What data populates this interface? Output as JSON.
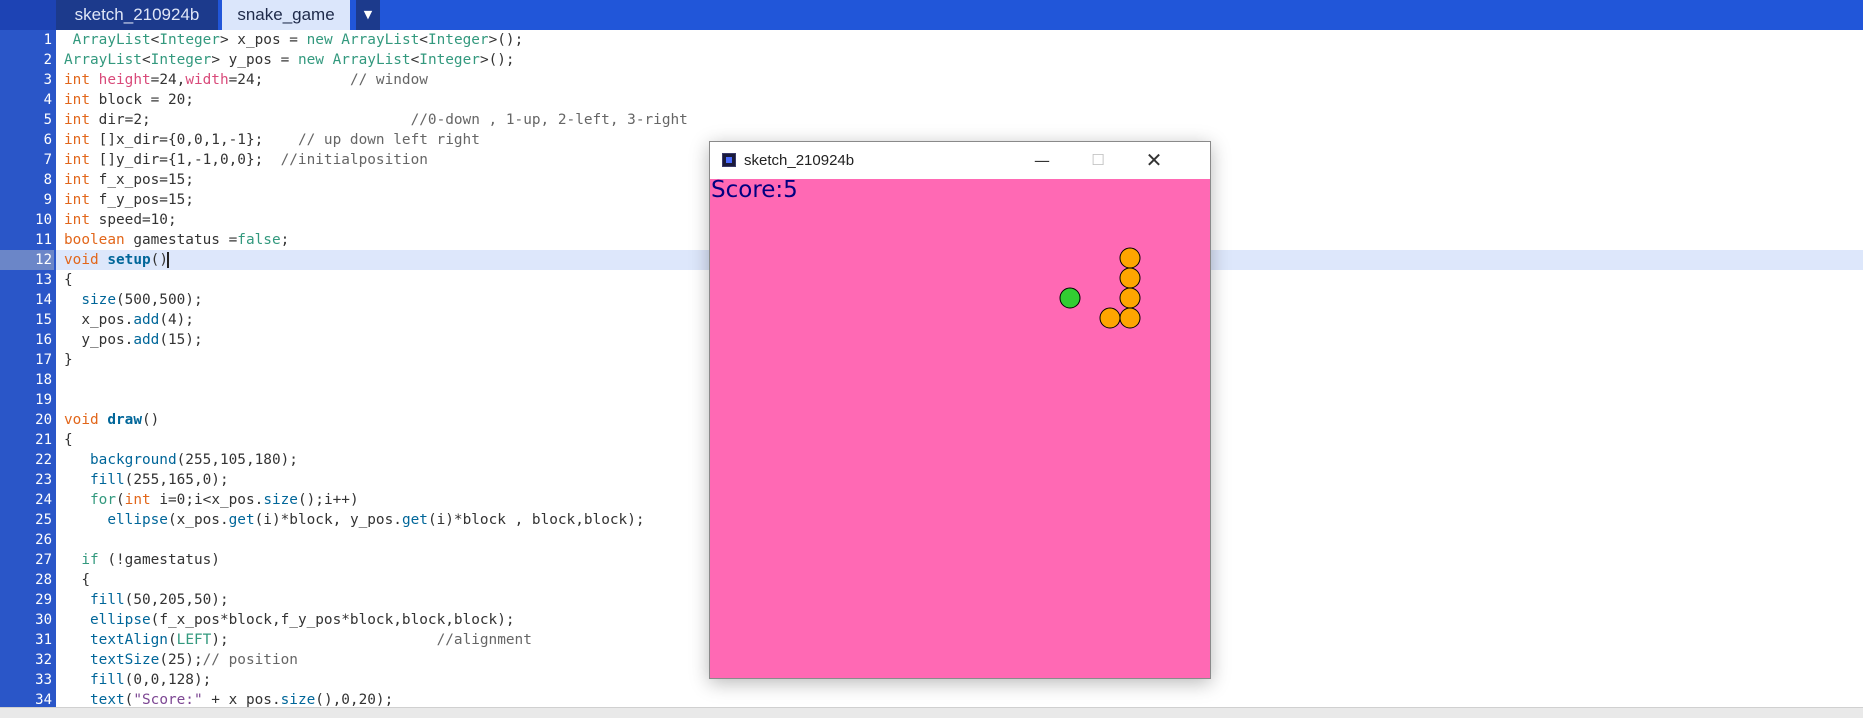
{
  "tabs": [
    {
      "label": "sketch_210924b"
    },
    {
      "label": "snake_game"
    }
  ],
  "tab_menu_icon": "dropdown-arrow-icon",
  "editor": {
    "current_line": 12,
    "line_numbers": [
      "1",
      "2",
      "3",
      "4",
      "5",
      "6",
      "7",
      "8",
      "9",
      "10",
      "11",
      "12",
      "13",
      "14",
      "15",
      "16",
      "17",
      "18",
      "19",
      "20",
      "21",
      "22",
      "23",
      "24",
      "25",
      "26",
      "27",
      "28",
      "29",
      "30",
      "31",
      "32",
      "33",
      "34"
    ],
    "lines": [
      " ArrayList<Integer> x_pos = new ArrayList<Integer>();",
      "ArrayList<Integer> y_pos = new ArrayList<Integer>();",
      "int height=24,width=24;          // window",
      "int block = 20;",
      "int dir=2;                              //0-down , 1-up, 2-left, 3-right",
      "int []x_dir={0,0,1,-1};    // up down left right",
      "int []y_dir={1,-1,0,0};  //initialposition",
      "int f_x_pos=15;",
      "int f_y_pos=15;",
      "int speed=10;",
      "boolean gamestatus =false;",
      "void setup()",
      "{",
      "  size(500,500);",
      "  x_pos.add(4);",
      "  y_pos.add(15);",
      "}",
      "",
      "",
      "void draw()",
      "{",
      "   background(255,105,180);",
      "   fill(255,165,0);",
      "   for(int i=0;i<x_pos.size();i++)",
      "     ellipse(x_pos.get(i)*block, y_pos.get(i)*block , block,block);",
      "",
      "  if (!gamestatus)",
      "  {",
      "   fill(50,205,50);",
      "   ellipse(f_x_pos*block,f_y_pos*block,block,block);",
      "   textAlign(LEFT);                        //alignment",
      "   textSize(25);// position",
      "   fill(0,0,128);",
      "   text(\"Score:\" + x_pos.size(),0,20);"
    ]
  },
  "sketch_window": {
    "title": "sketch_210924b",
    "score_text": "Score:5",
    "colors": {
      "background": "#ff69b4",
      "snake": "#ffa500",
      "food": "#32cd32",
      "score": "#000080"
    }
  }
}
